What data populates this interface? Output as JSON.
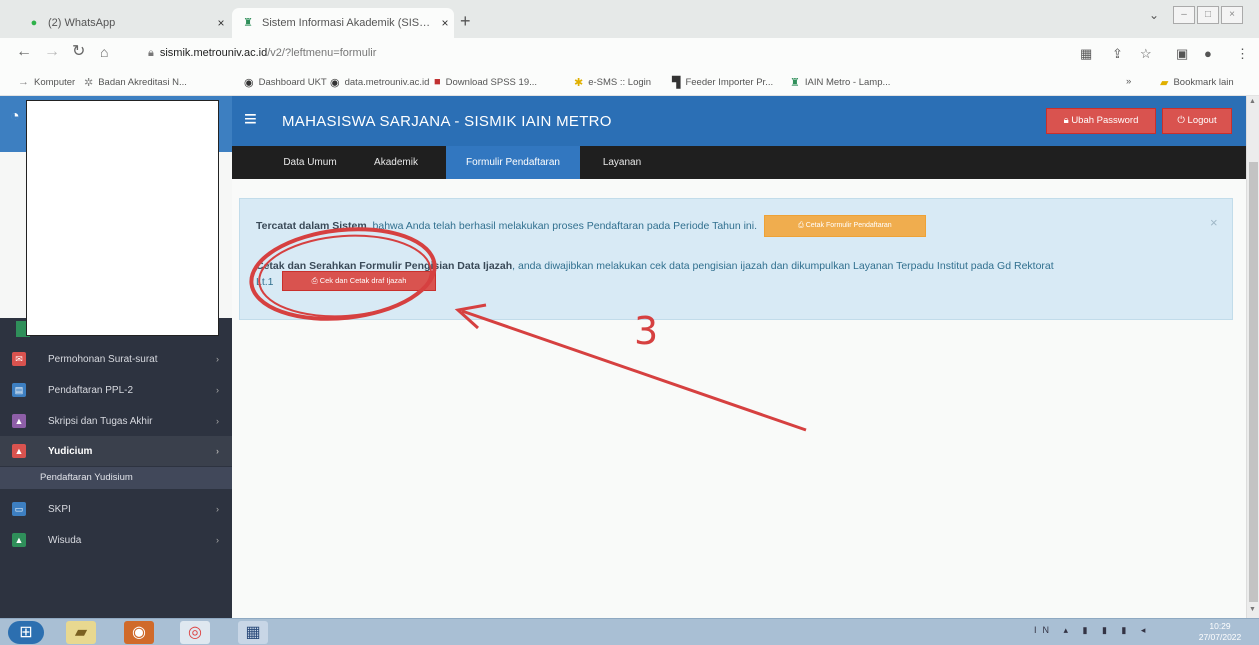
{
  "browser": {
    "tabs": [
      {
        "title": "(2) WhatsApp",
        "icon": "whatsapp-icon"
      },
      {
        "title": "Sistem Informasi Akademik (SIS…",
        "icon": "university-icon"
      }
    ],
    "url_host": "sismik.metrouniv.ac.id",
    "url_path": "/v2/?leftmenu=formulir",
    "bookmarks": [
      {
        "label": "Komputer",
        "icon": "arrow-icon"
      },
      {
        "label": "Badan Akreditasi N...",
        "icon": "star-icon"
      },
      {
        "label": "Dashboard UKT",
        "icon": "globe-icon"
      },
      {
        "label": "data.metrouniv.ac.id",
        "icon": "globe-icon"
      },
      {
        "label": "Download SPSS 19...",
        "icon": "download-icon"
      },
      {
        "label": "e-SMS :: Login",
        "icon": "sms-icon"
      },
      {
        "label": "Feeder Importer Pr...",
        "icon": "bookmark-icon"
      },
      {
        "label": "IAIN Metro - Lamp...",
        "icon": "university-icon"
      }
    ],
    "bookmarks_other": "Bookmark lain",
    "overflow": "»"
  },
  "app": {
    "title": "MAHASISWA SARJANA - SISMIK IAIN METRO",
    "ubah_password": "Ubah Password",
    "logout": "Logout",
    "menu": [
      {
        "label": "Data Umum",
        "active": false
      },
      {
        "label": "Akademik",
        "active": false
      },
      {
        "label": "Formulir Pendaftaran",
        "active": true
      },
      {
        "label": "Layanan",
        "active": false
      }
    ]
  },
  "sidebar": {
    "items": [
      {
        "label": "Permohonan Surat-surat",
        "icon": "mail-icon",
        "color": "#d9534f"
      },
      {
        "label": "Pendaftaran PPL-2",
        "icon": "clipboard-icon",
        "color": "#3d7fc1"
      },
      {
        "label": "Skripsi dan Tugas Akhir",
        "icon": "graduation-icon",
        "color": "#8e5fa8"
      },
      {
        "label": "Yudicium",
        "icon": "graduation-icon",
        "color": "#d9534f",
        "active": true
      },
      {
        "label": "SKPI",
        "icon": "certificate-icon",
        "color": "#3d7fc1"
      },
      {
        "label": "Wisuda",
        "icon": "graduation-icon",
        "color": "#2f8f5a"
      }
    ],
    "subitem": "Pendaftaran Yudisium"
  },
  "alert": {
    "line1_bold": "Tercatat dalam Sistem",
    "line1_text": ", bahwa Anda telah berhasil melakukan proses Pendaftaran pada Periode Tahun ini.",
    "cetak_form_label": "Cetak Formulir Pendaftaran",
    "line2_bold": "Cetak dan Serahkan Formulir Pengisian Data Ijazah",
    "line2_text": ", anda diwajibkan melakukan cek data pengisian ijazah dan dikumpulkan Layanan Terpadu Institut pada Gd Rektorat",
    "line2_tail": "Lt.1",
    "cetak_draft_label": "Cek dan Cetak draf Ijazah",
    "close": "×"
  },
  "annotation": {
    "number": "3",
    "color": "#d64040"
  },
  "taskbar": {
    "clock_time": "10:29",
    "clock_date": "27/07/2022",
    "tray": "IN"
  },
  "colors": {
    "navbar": "#2b6fb5",
    "menubar": "#1f1f1f",
    "sidebar": "#2d3340",
    "danger": "#d9534f",
    "warning": "#f0ad4e",
    "alert_bg": "#d8eaf5"
  }
}
